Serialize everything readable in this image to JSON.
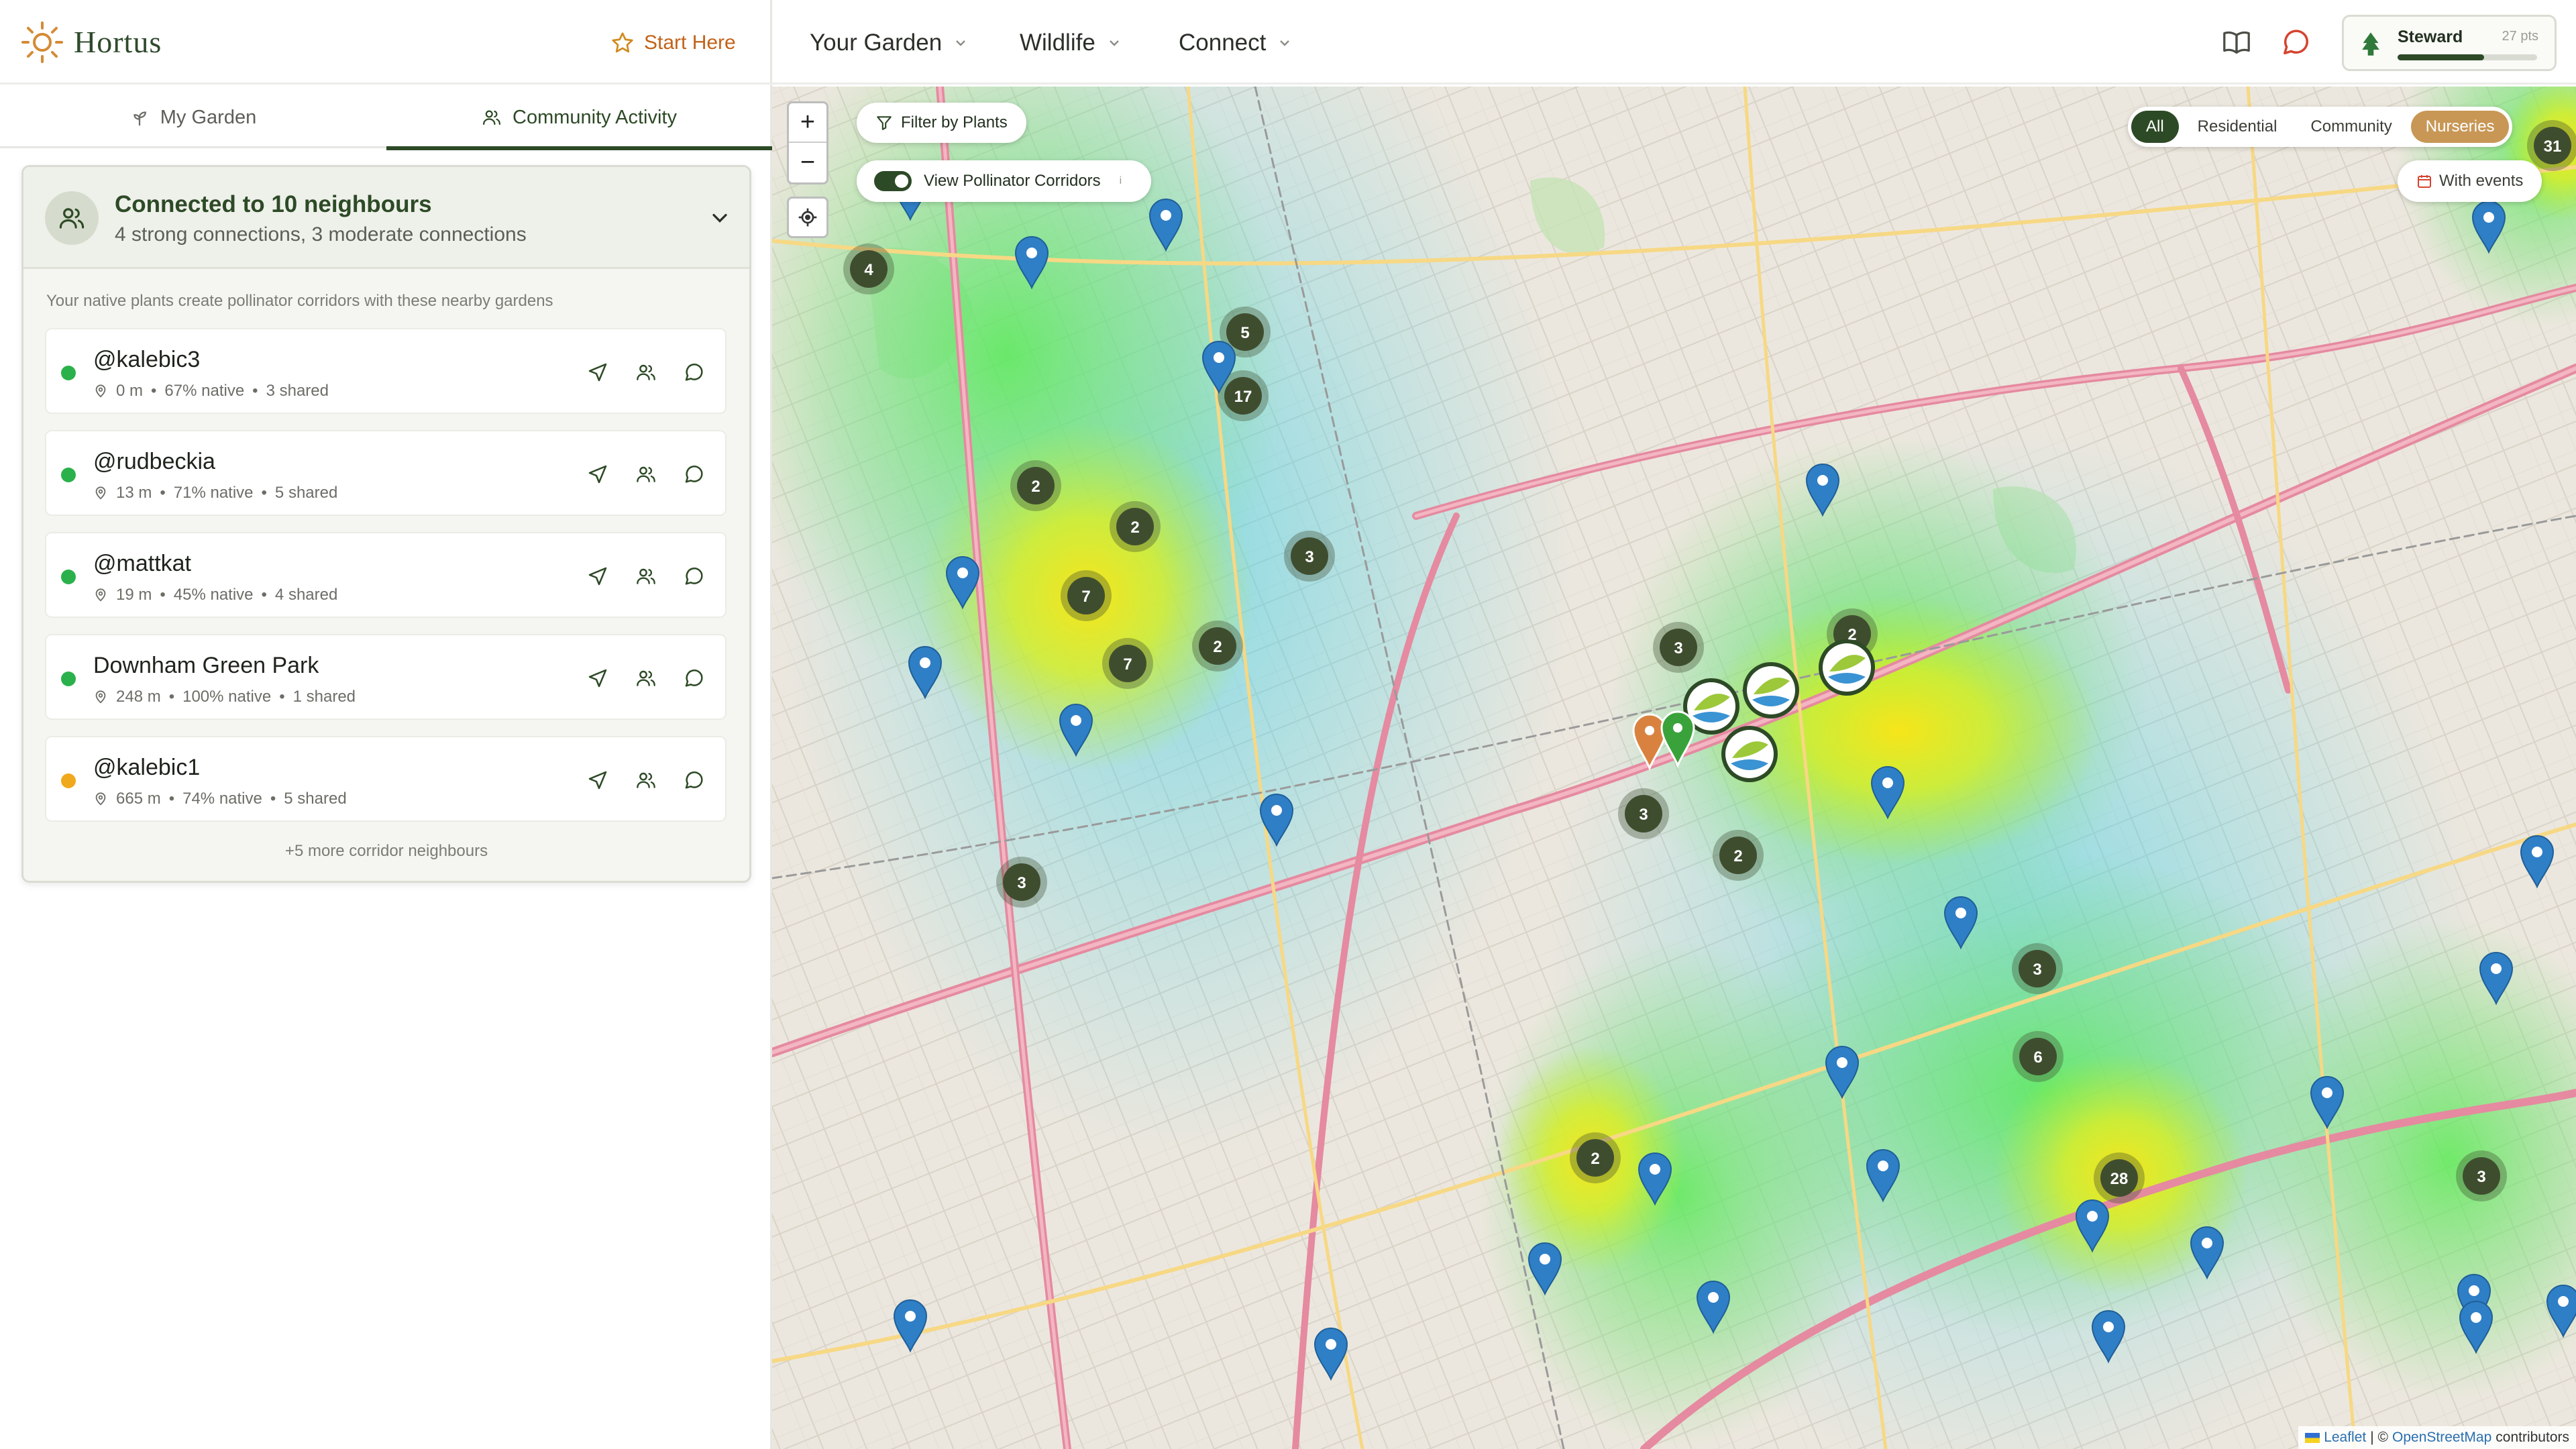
{
  "brand": {
    "name": "Hortus"
  },
  "header": {
    "start_here": "Start Here"
  },
  "nav": {
    "items": [
      "Your Garden",
      "Wildlife",
      "Connect"
    ]
  },
  "steward": {
    "label": "Steward",
    "points": "27 pts",
    "progress": 0.62
  },
  "tabs": {
    "my_garden": "My Garden",
    "community": "Community Activity"
  },
  "connections": {
    "title": "Connected to 10 neighbours",
    "subtitle": "4 strong connections, 3 moderate connections",
    "description": "Your native plants create pollinator corridors with these nearby gardens",
    "more": "+5 more corridor neighbours",
    "neighbours": [
      {
        "name": "@kalebic3",
        "distance": "0 m",
        "native": "67% native",
        "shared": "3 shared",
        "strength_color": "#2bb14c"
      },
      {
        "name": "@rudbeckia",
        "distance": "13 m",
        "native": "71% native",
        "shared": "5 shared",
        "strength_color": "#2bb14c"
      },
      {
        "name": "@mattkat",
        "distance": "19 m",
        "native": "45% native",
        "shared": "4 shared",
        "strength_color": "#2bb14c"
      },
      {
        "name": "Downham Green Park",
        "distance": "248 m",
        "native": "100% native",
        "shared": "1 shared",
        "strength_color": "#2bb14c"
      },
      {
        "name": "@kalebic1",
        "distance": "665 m",
        "native": "74% native",
        "shared": "5 shared",
        "strength_color": "#f0a91c"
      }
    ]
  },
  "map": {
    "filter_label": "Filter by Plants",
    "corridor_label": "View Pollinator Corridors",
    "corridor_on": true,
    "corridor_info": "i",
    "segments": [
      "All",
      "Residential",
      "Community",
      "Nurseries"
    ],
    "active_segment": "All",
    "events_label": "With events",
    "zoom_in": "+",
    "zoom_out": "−",
    "attribution": {
      "leaflet": "Leaflet",
      "sep": "| ©",
      "osm": "OpenStreetMap",
      "tail": "contributors"
    },
    "clusters": [
      "4",
      "5",
      "17",
      "2",
      "2",
      "3",
      "7",
      "7",
      "2",
      "3",
      "3",
      "2",
      "2",
      "3",
      "6",
      "2",
      "28",
      "3",
      "31",
      "3"
    ],
    "colors": {
      "accent": "#2d4a26",
      "nursery": "#c89756",
      "pin": "#2f7fc6"
    }
  }
}
